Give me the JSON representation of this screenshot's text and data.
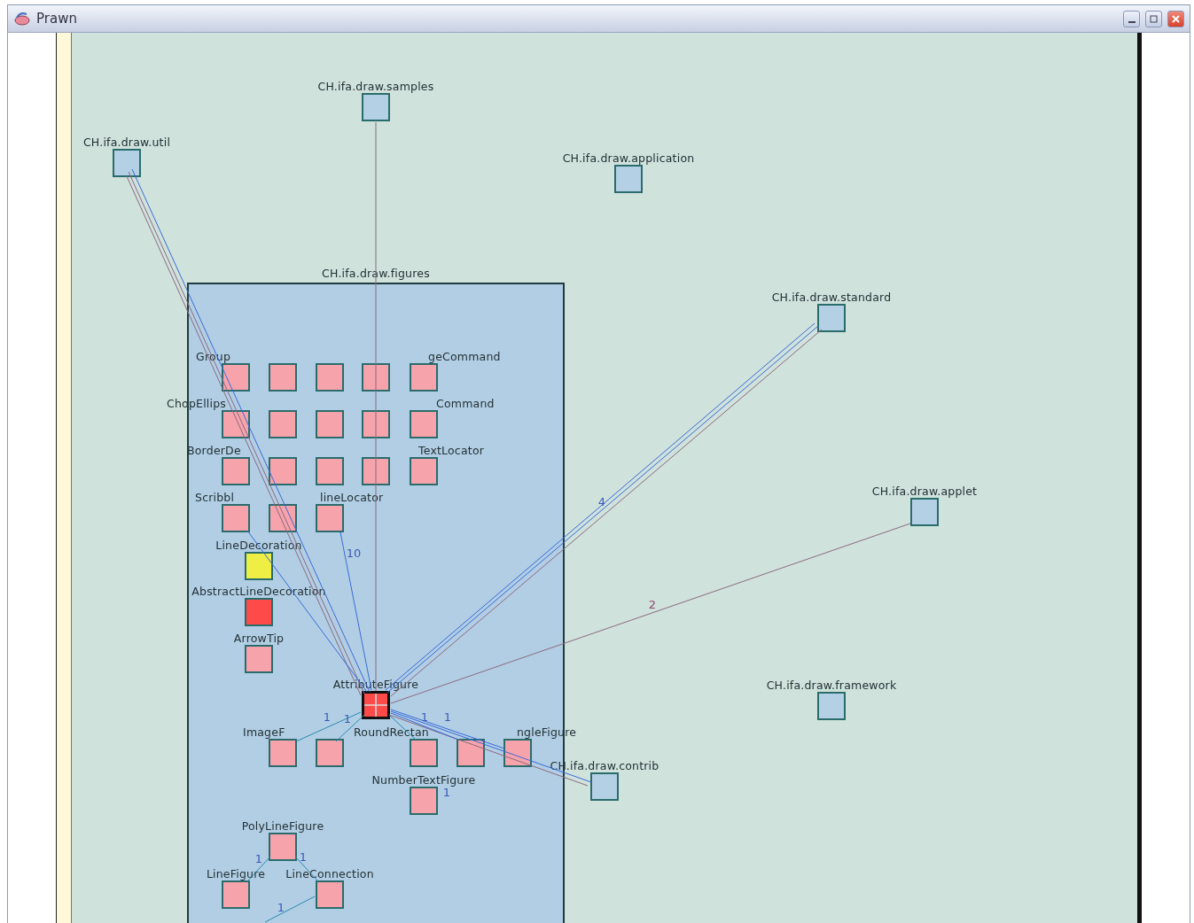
{
  "window": {
    "title": "Prawn"
  },
  "packages": [
    {
      "name": "CH.ifa.draw.samples"
    },
    {
      "name": "CH.ifa.draw.util"
    },
    {
      "name": "CH.ifa.draw.application"
    },
    {
      "name": "CH.ifa.draw.standard"
    },
    {
      "name": "CH.ifa.draw.applet"
    },
    {
      "name": "CH.ifa.draw.framework"
    },
    {
      "name": "CH.ifa.draw.contrib"
    }
  ],
  "container": {
    "name": "CH.ifa.draw.figures",
    "classes": [
      {
        "name": "Group",
        "color": "#f7a3ab",
        "selected": false
      },
      {
        "color": "#f7a3ab",
        "selected": false
      },
      {
        "color": "#f7a3ab",
        "selected": false
      },
      {
        "color": "#f7a3ab",
        "selected": false
      },
      {
        "name": "geCommand",
        "color": "#f7a3ab",
        "selected": false
      },
      {
        "name": "ChopEllips",
        "color": "#f7a3ab",
        "selected": false
      },
      {
        "color": "#f7a3ab",
        "selected": false
      },
      {
        "color": "#f7a3ab",
        "selected": false
      },
      {
        "color": "#f7a3ab",
        "selected": false
      },
      {
        "name": "Command",
        "color": "#f7a3ab",
        "selected": false
      },
      {
        "name": "BorderDe",
        "color": "#f7a3ab",
        "selected": false
      },
      {
        "color": "#f7a3ab",
        "selected": false
      },
      {
        "color": "#f7a3ab",
        "selected": false
      },
      {
        "color": "#f7a3ab",
        "selected": false
      },
      {
        "name": "TextLocator",
        "color": "#f7a3ab",
        "selected": false
      },
      {
        "name": "Scribbl",
        "color": "#f7a3ab",
        "selected": false
      },
      {
        "color": "#f7a3ab",
        "selected": false
      },
      {
        "name": "lineLocator",
        "color": "#f7a3ab",
        "selected": false
      },
      {
        "name": "LineDecoration",
        "color": "#eeee44",
        "selected": false
      },
      {
        "name": "AbstractLineDecoration",
        "color": "#ff4a4a",
        "selected": false
      },
      {
        "name": "ArrowTip",
        "color": "#f7a3ab",
        "selected": false
      },
      {
        "name": "AttributeFigure",
        "color": "#ff4a4a",
        "selected": true
      },
      {
        "name": "ImageF",
        "color": "#f7a3ab",
        "selected": false
      },
      {
        "color": "#f7a3ab",
        "selected": false
      },
      {
        "name": "RoundRectan",
        "color": "#f7a3ab",
        "selected": false
      },
      {
        "color": "#f7a3ab",
        "selected": false
      },
      {
        "name": "ngleFigure",
        "color": "#f7a3ab",
        "selected": false
      },
      {
        "name": "NumberTextFigure",
        "color": "#f7a3ab",
        "selected": false
      },
      {
        "name": "PolyLineFigure",
        "color": "#f7a3ab",
        "selected": false
      },
      {
        "name": "LineFigure",
        "color": "#f7a3ab",
        "selected": false
      },
      {
        "name": "LineConnection",
        "color": "#f7a3ab",
        "selected": false
      }
    ]
  },
  "edge_labels": [
    "4",
    "10",
    "2",
    "1",
    "1",
    "1",
    "1",
    "1",
    "1",
    "1",
    "1"
  ]
}
